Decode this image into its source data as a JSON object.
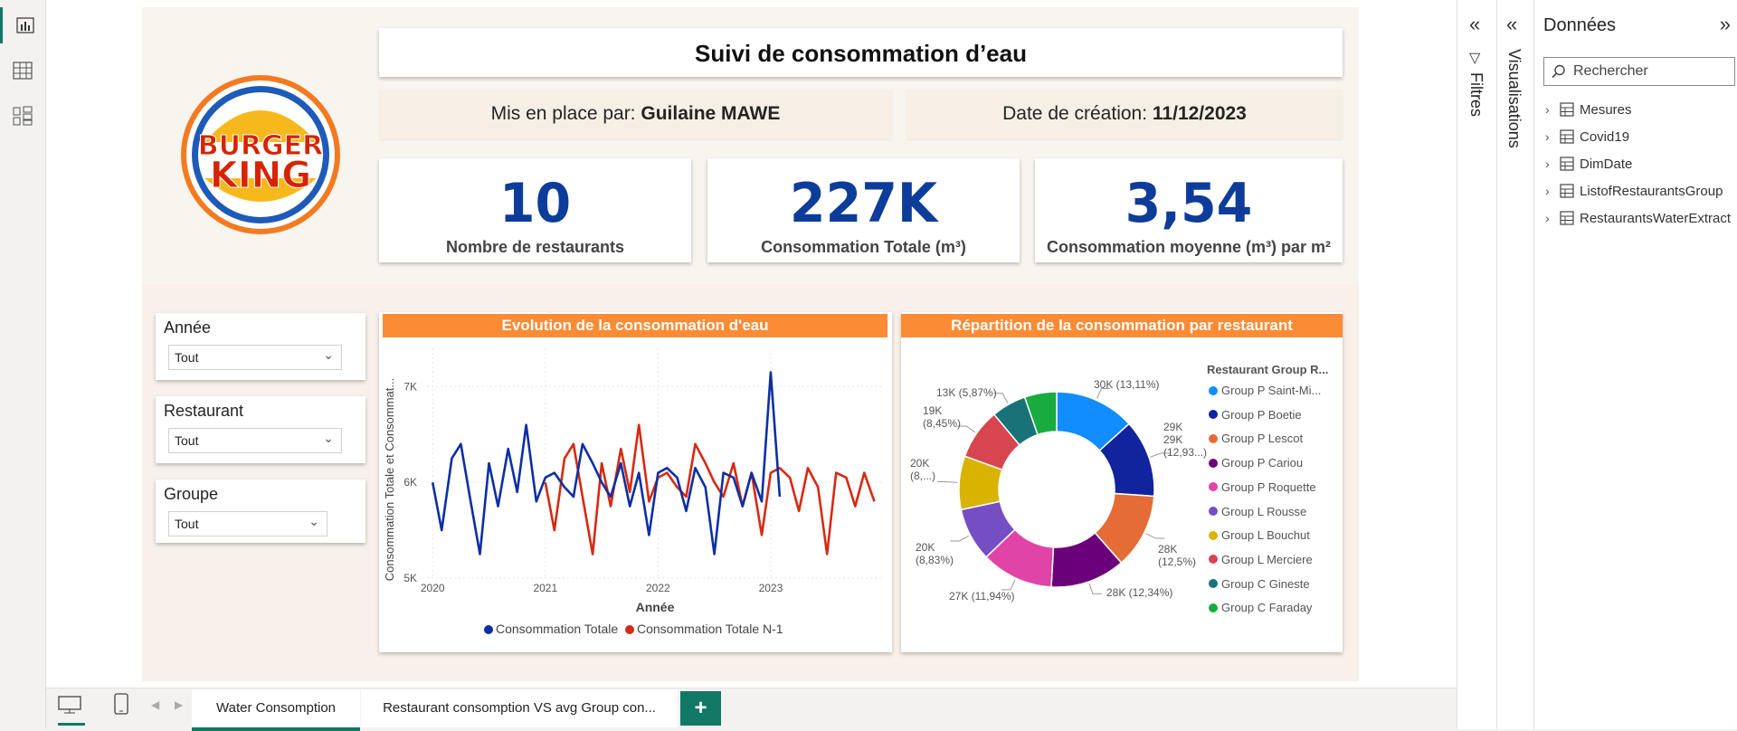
{
  "left_rail": {
    "items": [
      "report-view",
      "table-view",
      "model-view"
    ]
  },
  "header": {
    "title": "Suivi de consommation d’eau",
    "author_label": "Mis en place par:",
    "author_name": "Guilaine MAWE",
    "date_label": "Date de création:",
    "date_value": "11/12/2023"
  },
  "logo": {
    "line1": "BURGER",
    "line2": "KING"
  },
  "kpis": [
    {
      "value": "10",
      "label": "Nombre de restaurants"
    },
    {
      "value": "227K",
      "label": "Consommation Totale (m³)"
    },
    {
      "value": "3,54",
      "label": "Consommation moyenne (m³) par m²"
    }
  ],
  "slicers": [
    {
      "title": "Année",
      "value": "Tout"
    },
    {
      "title": "Restaurant",
      "value": "Tout"
    },
    {
      "title": "Groupe",
      "value": "Tout"
    }
  ],
  "line_chart": {
    "title": "Evolution de la consommation d'eau",
    "ylabel": "Consommation Totale et Consommat...",
    "xlabel": "Année",
    "yticks": [
      "7K",
      "6K",
      "5K"
    ],
    "xticks": [
      "2020",
      "2021",
      "2022",
      "2023"
    ],
    "legend": [
      "Consommation Totale",
      "Consommation Totale N-1"
    ]
  },
  "donut_chart": {
    "title": "Répartition de la consommation par restaurant",
    "legend_title": "Restaurant Group R...",
    "slice_labels": [
      "30K (13,11%)",
      "29K (12,93...)",
      "28K (12,5%)",
      "28K (12,34%)",
      "27K (11,94%)",
      "20K (8,83%)",
      "20K (8,...)",
      "19K (8,45%)",
      "13K (5,87%)",
      ""
    ]
  },
  "chart_data": [
    {
      "type": "line",
      "title": "Evolution de la consommation d'eau",
      "xlabel": "Année",
      "ylabel": "Consommation Totale et Consommat...",
      "ylim": [
        5000,
        7400
      ],
      "xlim": [
        2019.95,
        2023.98
      ],
      "grid": true,
      "legend_position": "bottom",
      "series": [
        {
          "name": "Consommation Totale",
          "color": "#0d2fa4",
          "x": [
            2020.0,
            2020.08,
            2020.17,
            2020.25,
            2020.33,
            2020.42,
            2020.5,
            2020.58,
            2020.67,
            2020.75,
            2020.83,
            2020.92,
            2021.0,
            2021.08,
            2021.17,
            2021.25,
            2021.33,
            2021.42,
            2021.5,
            2021.58,
            2021.67,
            2021.75,
            2021.83,
            2021.92,
            2022.0,
            2022.08,
            2022.17,
            2022.25,
            2022.33,
            2022.42,
            2022.5,
            2022.58,
            2022.67,
            2022.75,
            2022.83,
            2022.92,
            2023.0,
            2023.08
          ],
          "values": [
            6000,
            5500,
            6250,
            6400,
            5850,
            5250,
            6200,
            5750,
            6350,
            5900,
            6600,
            5800,
            6050,
            6100,
            5950,
            5850,
            6400,
            6200,
            6000,
            5850,
            6200,
            5750,
            6100,
            5450,
            6100,
            6150,
            6050,
            5700,
            6150,
            5950,
            5250,
            6100,
            6050,
            5750,
            6100,
            5800,
            7150,
            5850
          ]
        },
        {
          "name": "Consommation Totale N-1",
          "color": "#d62a12",
          "x": [
            2021.0,
            2021.08,
            2021.17,
            2021.25,
            2021.33,
            2021.42,
            2021.5,
            2021.58,
            2021.67,
            2021.75,
            2021.83,
            2021.92,
            2022.0,
            2022.08,
            2022.17,
            2022.25,
            2022.33,
            2022.42,
            2022.5,
            2022.58,
            2022.67,
            2022.75,
            2022.83,
            2022.92,
            2023.0,
            2023.08,
            2023.17,
            2023.25,
            2023.33,
            2023.42,
            2023.5,
            2023.58,
            2023.67,
            2023.75,
            2023.83,
            2023.92
          ],
          "values": [
            6000,
            5500,
            6250,
            6400,
            5850,
            5250,
            6200,
            5750,
            6350,
            5900,
            6600,
            5800,
            6050,
            6100,
            5950,
            5850,
            6400,
            6200,
            6000,
            5850,
            6200,
            5750,
            6100,
            5450,
            6100,
            6150,
            6050,
            5700,
            6150,
            5950,
            5250,
            6100,
            6050,
            5750,
            6100,
            5800
          ]
        }
      ]
    },
    {
      "type": "pie",
      "title": "Répartition de la consommation par restaurant",
      "legend_title": "Restaurant Group R...",
      "legend_position": "right",
      "categories": [
        "Group P Saint-Mi...",
        "Group P Boetie",
        "Group P Lescot",
        "Group P Cariou",
        "Group P Roquette",
        "Group L Rousse",
        "Group L Bouchut",
        "Group L Merciere",
        "Group C Gineste",
        "Group C Faraday"
      ],
      "values": [
        30000,
        29000,
        28000,
        28000,
        27000,
        20000,
        20000,
        19000,
        13000,
        12000
      ],
      "percents": [
        13.11,
        12.93,
        12.5,
        12.34,
        11.94,
        8.83,
        8.7,
        8.45,
        5.87,
        5.33
      ],
      "colors": [
        "#118dff",
        "#12239e",
        "#e66c37",
        "#6b007b",
        "#e044a7",
        "#744ec2",
        "#d9b300",
        "#d64550",
        "#197278",
        "#1aab40"
      ]
    }
  ],
  "tabs": [
    "Water Consomption",
    "Restaurant consomption VS avg Group con..."
  ],
  "add_tab": "+",
  "filters_pane": {
    "label": "Filtres"
  },
  "viz_pane": {
    "label": "Visualisations"
  },
  "data_pane": {
    "title": "Données",
    "search_placeholder": "Rechercher",
    "tables": [
      "Mesures",
      "Covid19",
      "DimDate",
      "ListofRestaurantsGroup",
      "RestaurantsWaterExtract"
    ]
  }
}
